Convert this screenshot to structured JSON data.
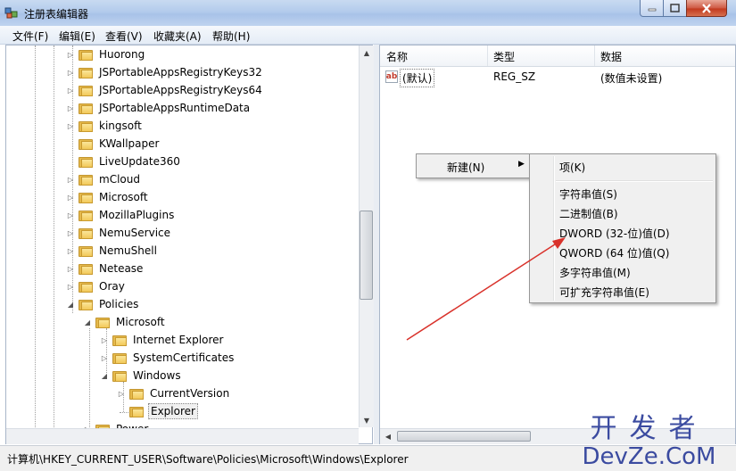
{
  "window": {
    "title": "注册表编辑器"
  },
  "menubar": {
    "items": [
      "文件(F)",
      "编辑(E)",
      "查看(V)",
      "收藏夹(A)",
      "帮助(H)"
    ]
  },
  "tree": {
    "items": [
      {
        "label": "Huorong",
        "depth": 0,
        "expander": "▷"
      },
      {
        "label": "JSPortableAppsRegistryKeys32",
        "depth": 0,
        "expander": "▷"
      },
      {
        "label": "JSPortableAppsRegistryKeys64",
        "depth": 0,
        "expander": "▷"
      },
      {
        "label": "JSPortableAppsRuntimeData",
        "depth": 0,
        "expander": "▷"
      },
      {
        "label": "kingsoft",
        "depth": 0,
        "expander": "▷"
      },
      {
        "label": "KWallpaper",
        "depth": 0,
        "expander": ""
      },
      {
        "label": "LiveUpdate360",
        "depth": 0,
        "expander": ""
      },
      {
        "label": "mCloud",
        "depth": 0,
        "expander": "▷"
      },
      {
        "label": "Microsoft",
        "depth": 0,
        "expander": "▷"
      },
      {
        "label": "MozillaPlugins",
        "depth": 0,
        "expander": "▷"
      },
      {
        "label": "NemuService",
        "depth": 0,
        "expander": "▷"
      },
      {
        "label": "NemuShell",
        "depth": 0,
        "expander": "▷"
      },
      {
        "label": "Netease",
        "depth": 0,
        "expander": "▷"
      },
      {
        "label": "Oray",
        "depth": 0,
        "expander": "▷"
      },
      {
        "label": "Policies",
        "depth": 0,
        "expander": "◢"
      },
      {
        "label": "Microsoft",
        "depth": 1,
        "expander": "◢"
      },
      {
        "label": "Internet Explorer",
        "depth": 2,
        "expander": "▷"
      },
      {
        "label": "SystemCertificates",
        "depth": 2,
        "expander": "▷"
      },
      {
        "label": "Windows",
        "depth": 2,
        "expander": "◢"
      },
      {
        "label": "CurrentVersion",
        "depth": 3,
        "expander": "▷"
      },
      {
        "label": "Explorer",
        "depth": 3,
        "expander": "",
        "selected": true
      },
      {
        "label": "Power",
        "depth": 1,
        "expander": "▷"
      }
    ]
  },
  "list": {
    "columns": [
      "名称",
      "类型",
      "数据"
    ],
    "rows": [
      {
        "name": "(默认)",
        "type": "REG_SZ",
        "data": "(数值未设置)"
      }
    ]
  },
  "context_menu": {
    "parent_label": "新建(N)",
    "items": [
      "项(K)",
      "字符串值(S)",
      "二进制值(B)",
      "DWORD (32-位)值(D)",
      "QWORD (64 位)值(Q)",
      "多字符串值(M)",
      "可扩充字符串值(E)"
    ]
  },
  "statusbar": {
    "path": "计算机\\HKEY_CURRENT_USER\\Software\\Policies\\Microsoft\\Windows\\Explorer"
  },
  "watermark": {
    "line1": "开发者",
    "line2": "DevZe.CoM"
  },
  "colors": {
    "arrow": "#d9322b",
    "title_bar": "#b3cbec"
  }
}
